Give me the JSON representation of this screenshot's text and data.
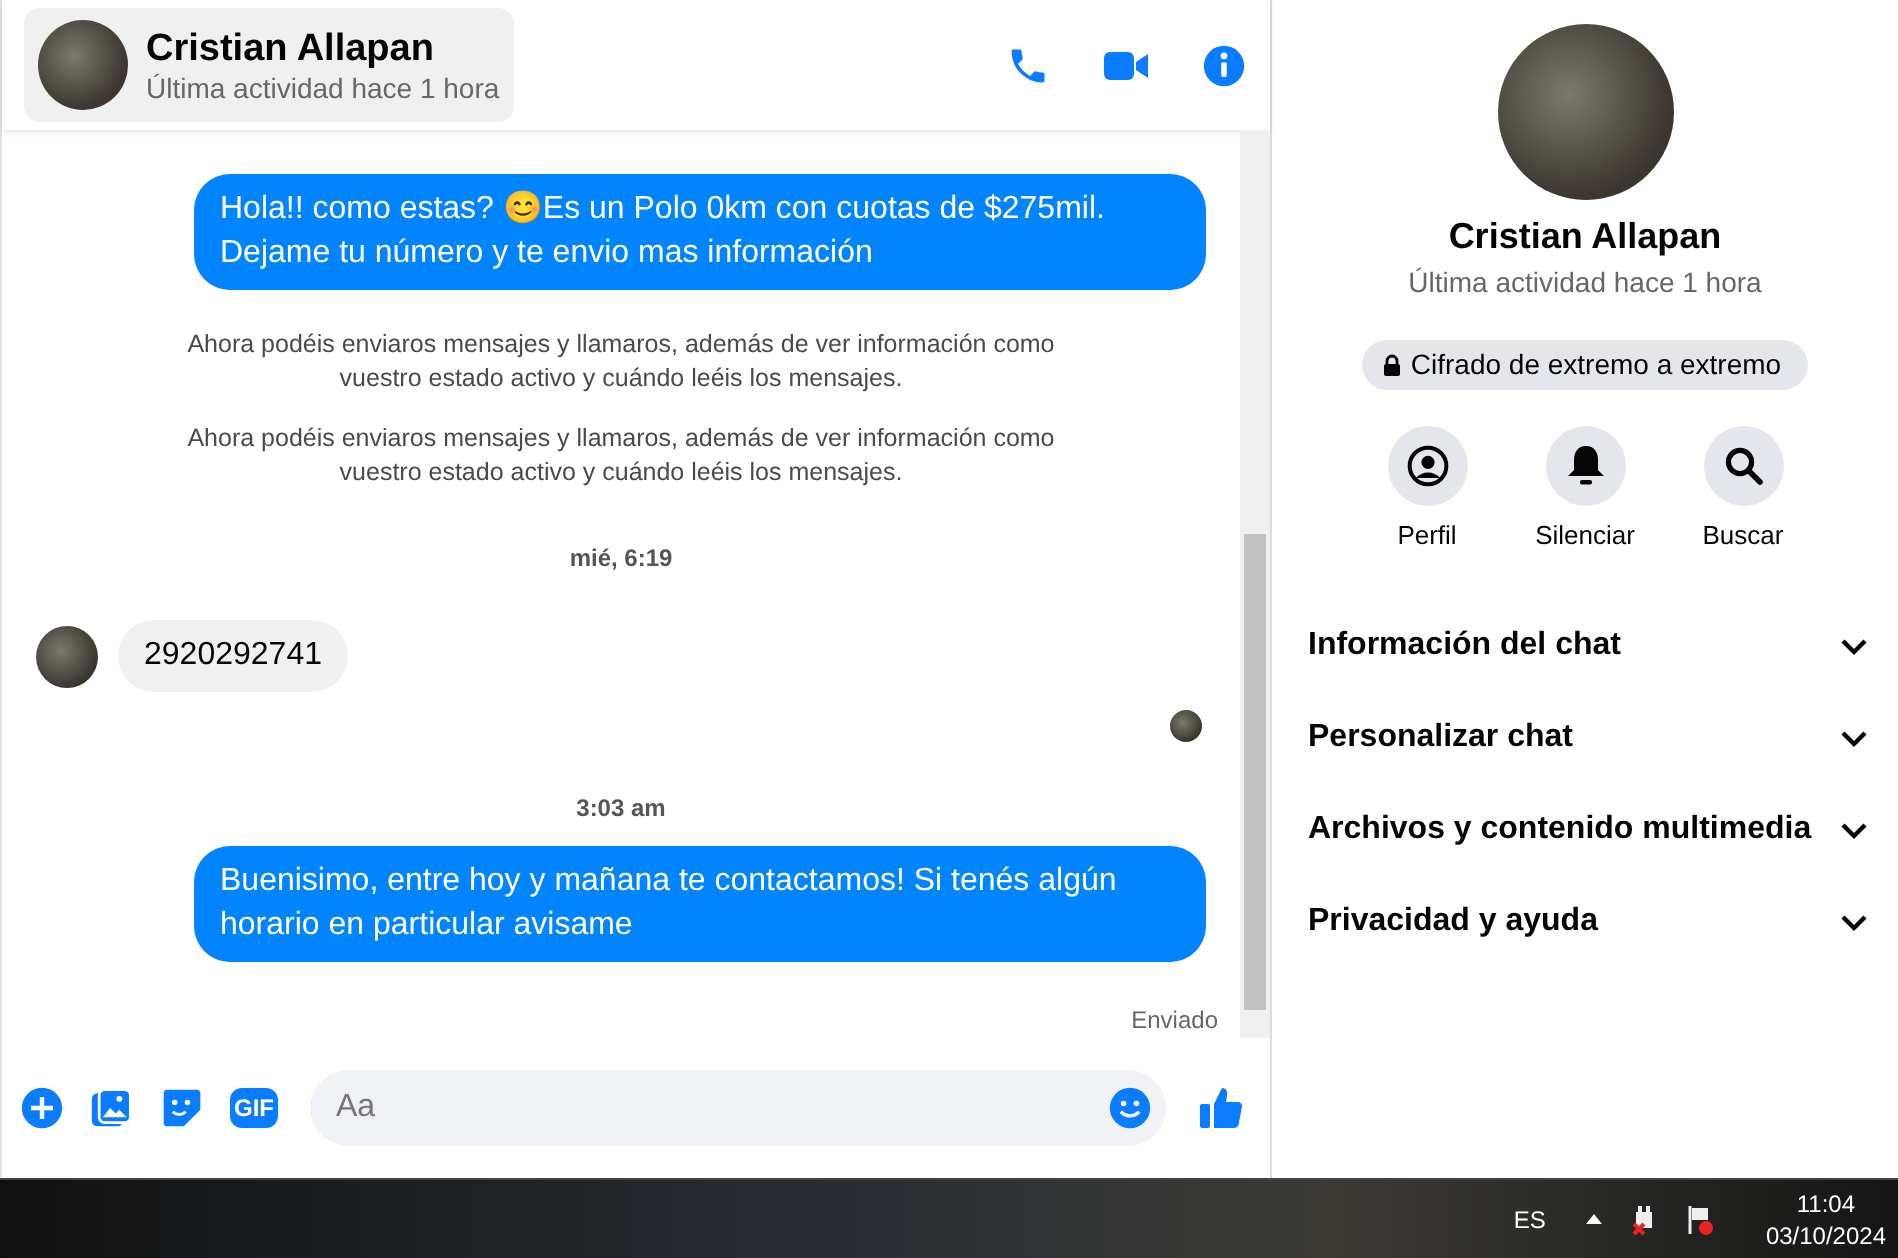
{
  "header": {
    "name": "Cristian Allapan",
    "status": "Última actividad hace 1 hora"
  },
  "messages": [
    {
      "kind": "outgoing",
      "text": "Hola!! como estas? 😊Es un Polo 0km con cuotas de $275mil. Dejame tu número y te envio mas información"
    },
    {
      "kind": "system",
      "text": "Ahora podéis enviaros mensajes y llamaros, además de ver información como vuestro estado activo y cuándo leéis los mensajes."
    },
    {
      "kind": "system",
      "text": "Ahora podéis enviaros mensajes y llamaros, además de ver información como vuestro estado activo y cuándo leéis los mensajes."
    },
    {
      "kind": "time",
      "text": "mié, 6:19"
    },
    {
      "kind": "incoming",
      "text": "2920292741"
    },
    {
      "kind": "seen"
    },
    {
      "kind": "time",
      "text": "3:03 am"
    },
    {
      "kind": "outgoing",
      "text": "Buenisimo, entre hoy y mañana te contactamos! Si tenés algún horario en particular avisame"
    },
    {
      "kind": "status",
      "text": "Enviado"
    }
  ],
  "composer": {
    "gif": "GIF",
    "placeholder": "Aa"
  },
  "profile": {
    "name": "Cristian Allapan",
    "status": "Última actividad hace 1 hora",
    "encryption": "Cifrado de extremo a extremo",
    "actions": [
      {
        "kind": "profile",
        "label": "Perfil"
      },
      {
        "kind": "mute",
        "label": "Silenciar"
      },
      {
        "kind": "search",
        "label": "Buscar"
      }
    ],
    "sections": [
      {
        "label": "Información del chat",
        "expanded": false
      },
      {
        "label": "Personalizar chat",
        "expanded": false
      },
      {
        "label": "Archivos y contenido multimedia",
        "expanded": false
      },
      {
        "label": "Privacidad y ayuda",
        "expanded": false
      }
    ]
  },
  "taskbar": {
    "language": "ES",
    "time": "11:04",
    "date": "03/10/2024"
  }
}
